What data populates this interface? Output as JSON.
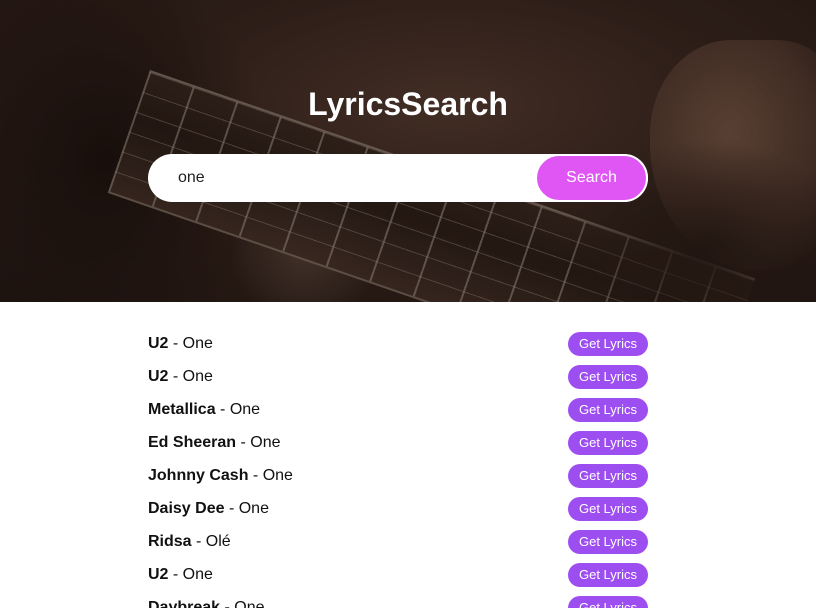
{
  "header": {
    "title": "LyricsSearch"
  },
  "search": {
    "value": "one",
    "button_label": "Search"
  },
  "results": {
    "button_label": "Get Lyrics",
    "separator": " - ",
    "items": [
      {
        "artist": "U2",
        "song": "One"
      },
      {
        "artist": "U2",
        "song": "One"
      },
      {
        "artist": "Metallica",
        "song": "One"
      },
      {
        "artist": "Ed Sheeran",
        "song": "One"
      },
      {
        "artist": "Johnny Cash",
        "song": "One"
      },
      {
        "artist": "Daisy Dee",
        "song": "One"
      },
      {
        "artist": "Ridsa",
        "song": "Olé"
      },
      {
        "artist": "U2",
        "song": "One"
      },
      {
        "artist": "Daybreak",
        "song": "One"
      }
    ]
  },
  "colors": {
    "search_button": "#e056f5",
    "get_lyrics_button": "#9d4ef0"
  }
}
